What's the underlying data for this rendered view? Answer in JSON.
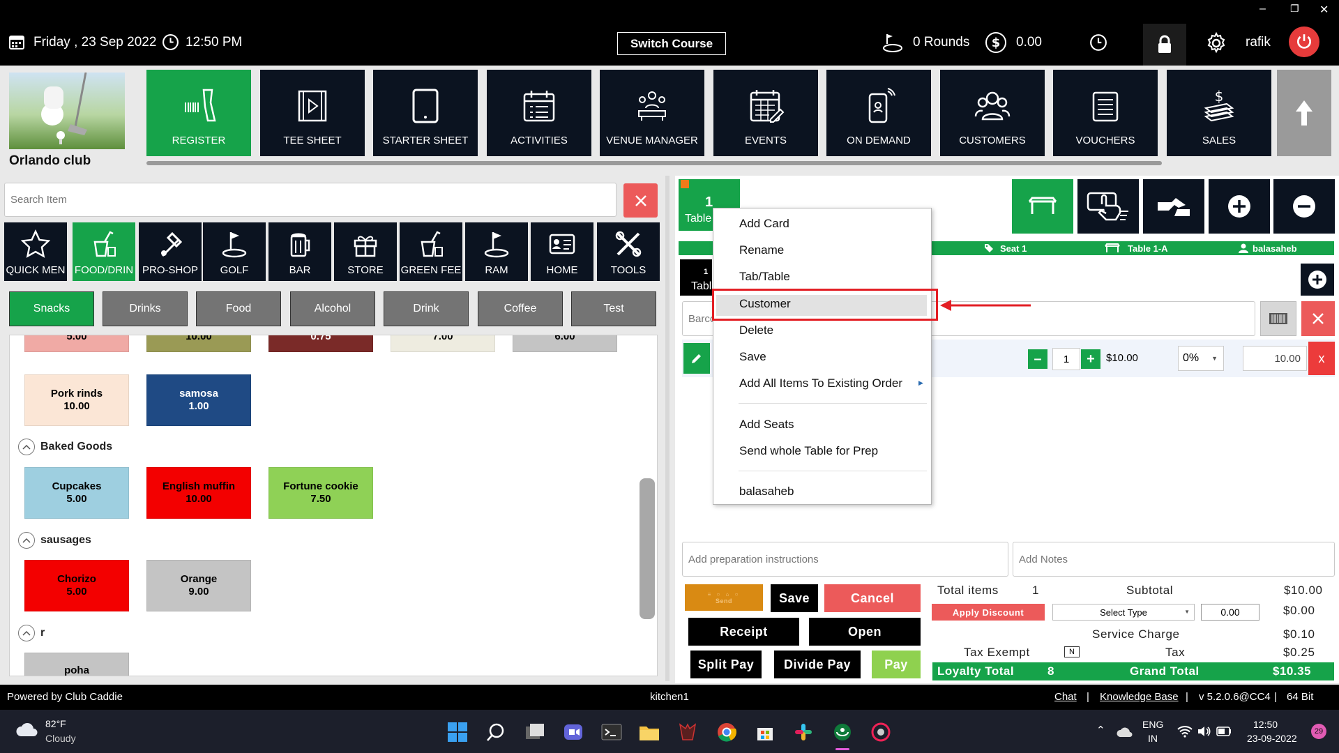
{
  "window": {
    "minimize": "–",
    "restore": "❐",
    "close": "✕"
  },
  "topbar": {
    "date": "Friday ,  23 Sep 2022",
    "time": "12:50 PM",
    "switch_course": "Switch Course",
    "rounds": "0 Rounds",
    "balance": "0.00",
    "user": "rafik"
  },
  "brand": {
    "club_name": "Orlando club"
  },
  "nav": {
    "items": [
      {
        "label": "REGISTER",
        "icon": "barcode-scanner-icon",
        "active": true
      },
      {
        "label": "TEE SHEET",
        "icon": "tee-sheet-icon"
      },
      {
        "label": "STARTER SHEET",
        "icon": "tablet-icon"
      },
      {
        "label": "ACTIVITIES",
        "icon": "calendar-list-icon"
      },
      {
        "label": "VENUE MANAGER",
        "icon": "venue-icon"
      },
      {
        "label": "EVENTS",
        "icon": "events-calendar-icon"
      },
      {
        "label": "ON DEMAND",
        "icon": "mobile-wifi-icon"
      },
      {
        "label": "CUSTOMERS",
        "icon": "customers-icon"
      },
      {
        "label": "VOUCHERS",
        "icon": "voucher-icon"
      },
      {
        "label": "SALES",
        "icon": "sales-icon"
      }
    ]
  },
  "search": {
    "placeholder": "Search Item"
  },
  "categories": [
    {
      "label": "QUICK MEN",
      "icon": "star-icon"
    },
    {
      "label": "FOOD/DRIN",
      "icon": "food-drink-icon",
      "active": true
    },
    {
      "label": "PRO-SHOP",
      "icon": "pro-shop-icon"
    },
    {
      "label": "GOLF",
      "icon": "golf-icon"
    },
    {
      "label": "BAR",
      "icon": "beer-icon"
    },
    {
      "label": "STORE",
      "icon": "gift-icon"
    },
    {
      "label": "GREEN FEE",
      "icon": "drink-icon"
    },
    {
      "label": "RAM",
      "icon": "golf-icon"
    },
    {
      "label": "HOME",
      "icon": "id-card-icon"
    },
    {
      "label": "TOOLS",
      "icon": "tools-icon"
    }
  ],
  "subtabs": [
    {
      "label": "Snacks",
      "active": true
    },
    {
      "label": "Drinks"
    },
    {
      "label": "Food"
    },
    {
      "label": "Alcohol"
    },
    {
      "label": "Drink"
    },
    {
      "label": "Coffee"
    },
    {
      "label": "Test"
    }
  ],
  "items": {
    "partial_row": [
      {
        "price": "5.00",
        "color": "#f0aaa5"
      },
      {
        "price": "10.00",
        "color": "#9a9a55"
      },
      {
        "price": "0.75",
        "color": "#7a2a28"
      },
      {
        "price": "7.00",
        "color": "#eeece0"
      },
      {
        "price": "6.00",
        "color": "#c4c4c4"
      }
    ],
    "snacks_row2": [
      {
        "name": "Pork rinds",
        "price": "10.00",
        "color": "#fbe6d6"
      },
      {
        "name": "samosa",
        "price": "1.00",
        "color": "#1f4a84"
      }
    ],
    "sections": [
      {
        "title": "Baked Goods",
        "items": [
          {
            "name": "Cupcakes",
            "price": "5.00",
            "color": "#9ecfe0"
          },
          {
            "name": "English muffin",
            "price": "10.00",
            "color": "#f30000"
          },
          {
            "name": "Fortune cookie",
            "price": "7.50",
            "color": "#8fd156"
          }
        ]
      },
      {
        "title": "sausages",
        "items": [
          {
            "name": "Chorizo",
            "price": "5.00",
            "color": "#f30000"
          },
          {
            "name": "Orange",
            "price": "9.00",
            "color": "#c4c4c4"
          }
        ]
      },
      {
        "title": "r",
        "items": [
          {
            "name": "poha",
            "price": "",
            "color": "#c4c4c4"
          }
        ]
      }
    ]
  },
  "order": {
    "table_tab": {
      "number": "1",
      "label": "Table"
    },
    "seat_tab": {
      "number": "1",
      "label": "Tabl"
    },
    "seat_bar": {
      "seat": "Seat 1",
      "table": "Table 1-A",
      "user": "balasaheb"
    },
    "barcode_placeholder": "Barco",
    "line": {
      "qty": "1",
      "price": "$10.00",
      "discount": "0%",
      "total": "10.00"
    },
    "prep_placeholder": "Add preparation instructions",
    "notes_placeholder": "Add Notes"
  },
  "context_menu": {
    "items": [
      "Add Card",
      "Rename",
      "Tab/Table",
      "Customer",
      "Delete",
      "Save",
      "Add All Items To Existing Order"
    ],
    "items2": [
      "Add Seats",
      "Send whole Table for Prep"
    ],
    "items3": [
      "balasaheb"
    ],
    "highlighted": "Customer"
  },
  "actions": {
    "send": "Send",
    "save": "Save",
    "cancel": "Cancel",
    "receipt": "Receipt",
    "open": "Open",
    "split_pay": "Split Pay",
    "divide_pay": "Divide Pay",
    "pay": "Pay",
    "apply_discount": "Apply Discount",
    "select_type": "Select Type",
    "discount_value": "0.00"
  },
  "summary": {
    "total_items_label": "Total items",
    "total_items": "1",
    "subtotal_label": "Subtotal",
    "subtotal": "$10.00",
    "discount_amount": "$0.00",
    "service_charge_label": "Service Charge",
    "service_charge": "$0.10",
    "tax_exempt_label": "Tax Exempt",
    "tax_exempt_box": "N",
    "tax_label": "Tax",
    "tax": "$0.25",
    "loyalty_label": "Loyalty Total",
    "loyalty": "8",
    "grand_total_label": "Grand Total",
    "grand_total": "$10.35"
  },
  "footer": {
    "powered": "Powered by Club Caddie",
    "station": "kitchen1",
    "chat": "Chat",
    "sep": "|",
    "kb": "Knowledge Base",
    "version": "v 5.2.0.6@CC4",
    "bits": "64 Bit"
  },
  "taskbar": {
    "weather_temp": "82°F",
    "weather_desc": "Cloudy",
    "lang1": "ENG",
    "lang2": "IN",
    "time": "12:50",
    "date": "23-09-2022",
    "badge": "29"
  },
  "colors": {
    "green": "#16a34a",
    "dark": "#0b1320",
    "red": "#ec5a5a",
    "orange": "#f07a1a"
  }
}
